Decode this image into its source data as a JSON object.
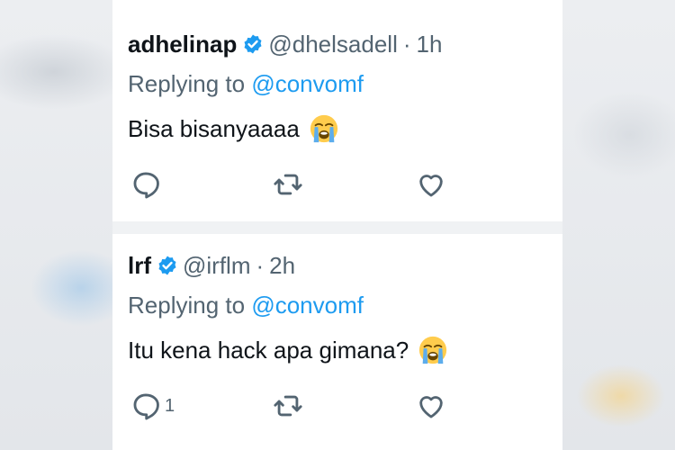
{
  "tweets": [
    {
      "name": "adhelinap",
      "handle": "@dhelsadell",
      "separator": "·",
      "time": "1h",
      "replying_prefix": "Replying to",
      "replying_to": "@convomf",
      "text": "Bisa bisanyaaaa",
      "emoji": "loudly-crying-face",
      "reply_count": ""
    },
    {
      "name": "lrf",
      "handle": "@irflm",
      "separator": "·",
      "time": "2h",
      "replying_prefix": "Replying to",
      "replying_to": "@convomf",
      "text": "Itu kena hack apa gimana?",
      "emoji": "loudly-crying-face",
      "reply_count": "1"
    }
  ],
  "colors": {
    "accent": "#1d9bf0",
    "text": "#0f1419",
    "muted": "#536471"
  }
}
